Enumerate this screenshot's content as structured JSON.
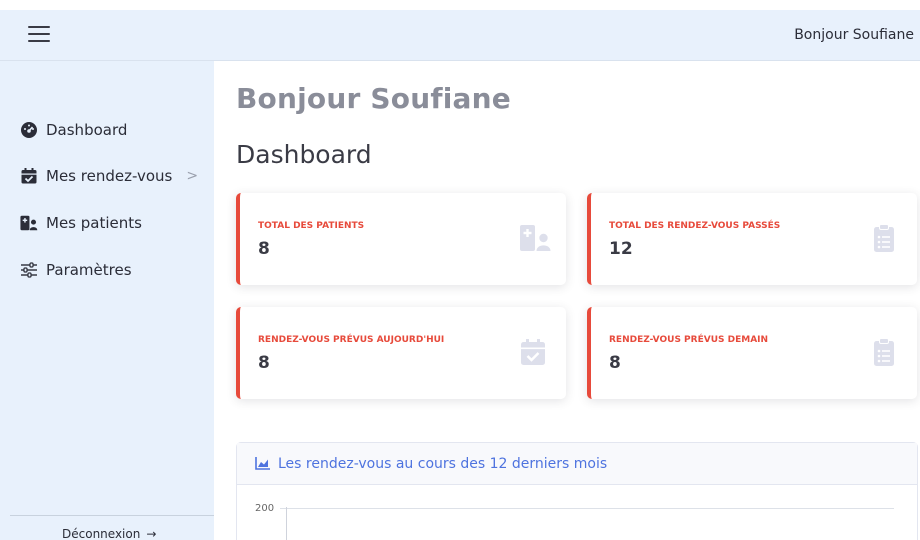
{
  "topbar": {
    "greeting": "Bonjour Soufiane"
  },
  "sidebar": {
    "items": [
      {
        "label": "Dashboard",
        "icon": "tachometer-icon"
      },
      {
        "label": "Mes rendez-vous",
        "icon": "calendar-check-icon",
        "chevron": ">"
      },
      {
        "label": "Mes patients",
        "icon": "hospital-user-icon"
      },
      {
        "label": "Paramètres",
        "icon": "sliders-icon"
      }
    ],
    "logout_label": "Déconnexion",
    "logout_icon": "→"
  },
  "main": {
    "greeting": "Bonjour Soufiane",
    "title": "Dashboard",
    "cards": [
      {
        "label": "TOTAL DES PATIENTS",
        "value": "8",
        "icon": "hospital-user-icon"
      },
      {
        "label": "TOTAL DES RENDEZ-VOUS PASSÉS",
        "value": "12",
        "icon": "clipboard-list-icon"
      },
      {
        "label": "RENDEZ-VOUS PRÉVUS AUJOURD'HUI",
        "value": "8",
        "icon": "calendar-check-icon"
      },
      {
        "label": "RENDEZ-VOUS PRÉVUS DEMAIN",
        "value": "8",
        "icon": "clipboard-list-icon"
      }
    ],
    "chart": {
      "title": "Les rendez-vous au cours des 12 derniers mois",
      "y_top_tick": "200"
    }
  },
  "colors": {
    "accent_red": "#e74a3b",
    "accent_blue": "#4e73df",
    "sidebar_bg": "#e8f1fc",
    "icon_gray": "#dddfeb"
  }
}
